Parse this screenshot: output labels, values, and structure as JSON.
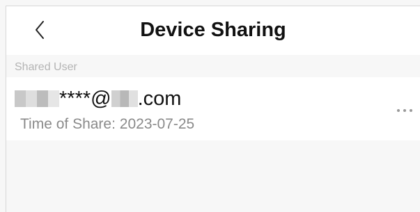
{
  "header": {
    "title": "Device Sharing",
    "back_icon": "chevron-left-icon"
  },
  "shared_users": {
    "section_label": "Shared User",
    "items": [
      {
        "email_visible_part": "****@",
        "email_suffix": ".com",
        "share_time_label": "Time of Share:",
        "share_time_value": "2023-07-25",
        "more_icon": "more-horizontal-icon"
      }
    ]
  }
}
